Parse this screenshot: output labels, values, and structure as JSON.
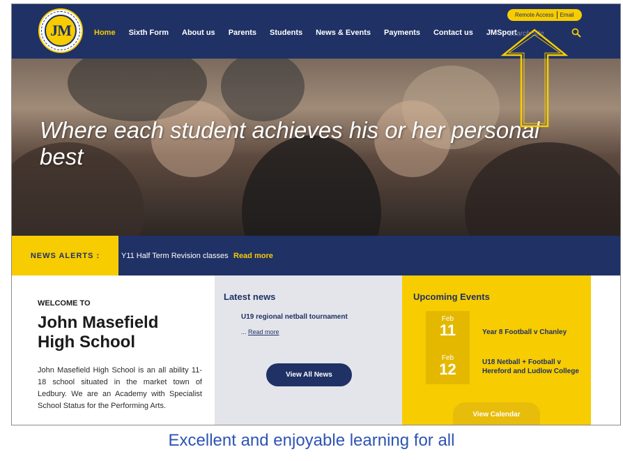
{
  "header": {
    "logo_text": "JM",
    "nav": [
      {
        "label": "Home",
        "active": true
      },
      {
        "label": "Sixth Form"
      },
      {
        "label": "About us"
      },
      {
        "label": "Parents"
      },
      {
        "label": "Students"
      },
      {
        "label": "News & Events"
      },
      {
        "label": "Payments"
      },
      {
        "label": "Contact us"
      },
      {
        "label": "JMSport"
      }
    ],
    "remote_access": "Remote Access",
    "email": "Email",
    "search_placeholder": "Search Site"
  },
  "hero": {
    "title": "Where each student achieves his or her personal best"
  },
  "alerts": {
    "label": "NEWS ALERTS :",
    "text": "Y11 Half Term Revision classes",
    "more": "Read more"
  },
  "welcome": {
    "pre": "WELCOME TO",
    "name": "John Masefield High School",
    "text": "John Masefield High School is an all ability 11-18 school situated in the market town of Ledbury. We are an Academy with Specialist School Status for the Performing Arts."
  },
  "news": {
    "title": "Latest news",
    "item": "U19 regional netball tournament",
    "more_prefix": "... ",
    "more": "Read more",
    "button": "View All News"
  },
  "events": {
    "title": "Upcoming Events",
    "items": [
      {
        "month": "Feb",
        "day": "11",
        "text": "Year 8 Football v Chanley"
      },
      {
        "month": "Feb",
        "day": "12",
        "text": "U18 Netball + Football v Hereford and Ludlow College"
      }
    ],
    "button": "View Calendar"
  },
  "slogan": "Excellent and enjoyable learning for all",
  "colors": {
    "navy": "#1f3165",
    "yellow": "#f7cc00",
    "slogan_blue": "#2d54b3"
  }
}
